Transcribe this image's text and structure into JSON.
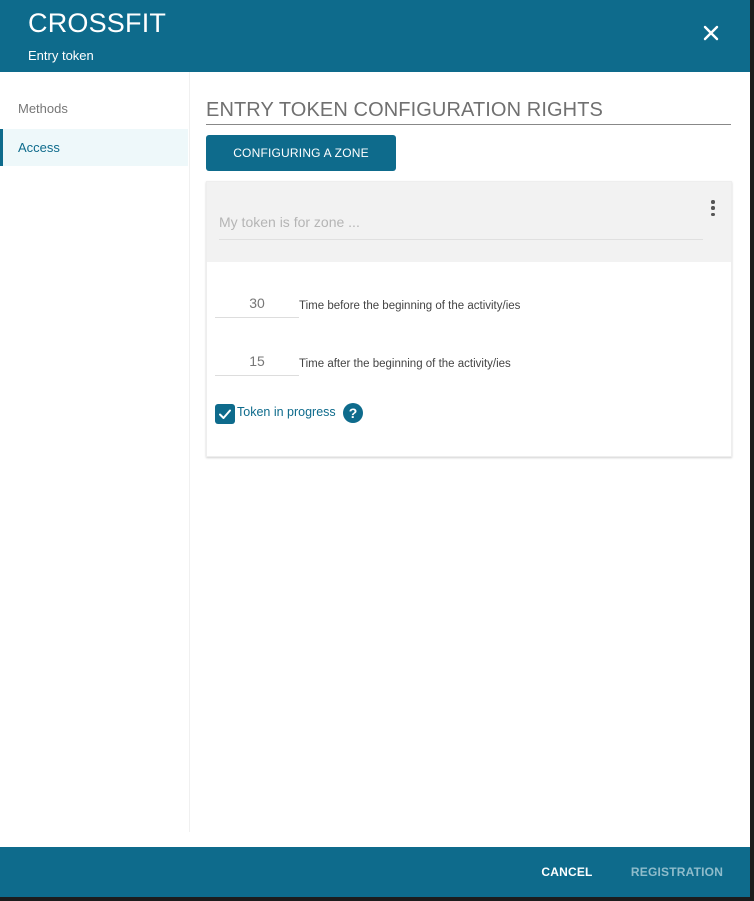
{
  "header": {
    "title": "CROSSFIT",
    "subtitle": "Entry token"
  },
  "sidebar": {
    "items": [
      {
        "label": "Methods",
        "active": false
      },
      {
        "label": "Access",
        "active": true
      }
    ]
  },
  "main": {
    "title": "ENTRY TOKEN CONFIGURATION RIGHTS",
    "configure_button": "CONFIGURING A ZONE",
    "card": {
      "zone_placeholder": "My token is for zone ...",
      "zone_value": "",
      "fields": [
        {
          "value": "30",
          "label": "Time before the beginning of the activity/ies"
        },
        {
          "value": "15",
          "label": "Time after the beginning of the activity/ies"
        }
      ],
      "checkbox": {
        "label": "Token in progress",
        "checked": true
      },
      "help_glyph": "?"
    }
  },
  "footer": {
    "cancel_label": "CANCEL",
    "registration_label": "REGISTRATION"
  },
  "colors": {
    "primary": "#0e6b8c",
    "disabled_text": "#8fbccb"
  },
  "icons": [
    "close-icon",
    "more-vert-icon",
    "checkmark-icon",
    "help-icon"
  ]
}
